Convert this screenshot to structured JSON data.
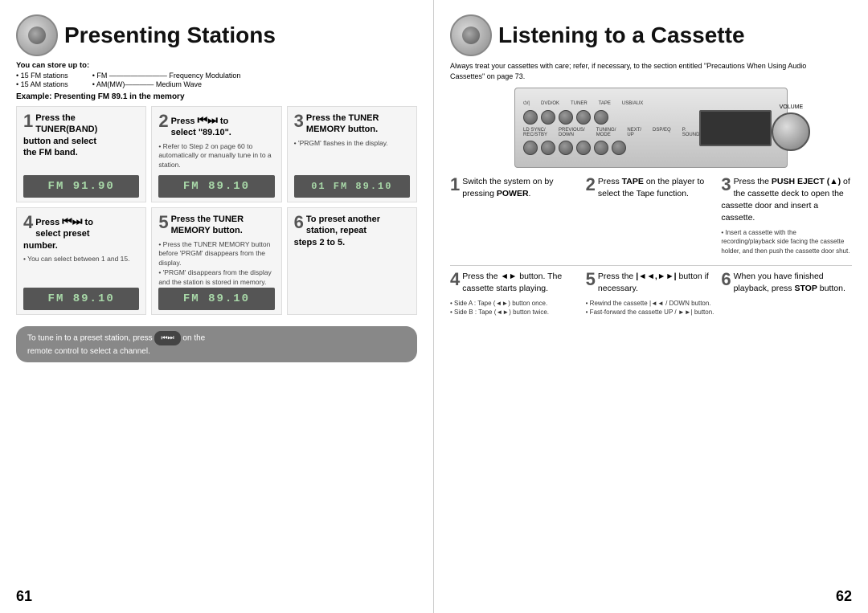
{
  "left": {
    "title": "Presenting Stations",
    "speaker_alt": "speaker icon",
    "info": {
      "title": "You can store up to:",
      "col1": [
        "• 15 FM stations",
        "• 15 AM stations"
      ],
      "col2": [
        "• FM ————————— Frequency Modulation",
        "• AM(MW)————— Medium Wave"
      ]
    },
    "example_header": "Example: Presenting FM 89.1 in the memory",
    "steps": [
      {
        "number": "1",
        "title": "Press the TUNER(BAND) button  and select the FM band.",
        "body": "",
        "notes": "",
        "lcd": "FM 91.90"
      },
      {
        "number": "2",
        "title": "Press  to select \"89.10\".",
        "body": "",
        "notes": "• Refer to Step 2 on page 60 to automatically or manually tune in to a station.",
        "lcd": "FM 89.10"
      },
      {
        "number": "3",
        "title": "Press the TUNER MEMORY button.",
        "body": "",
        "notes": "• 'PRGM' flashes in the display.",
        "lcd": "01 FM 89.10"
      },
      {
        "number": "4",
        "title": "Press  to select preset number.",
        "body": "",
        "notes": "• You can select between 1 and 15.",
        "lcd": "FM 89.10"
      },
      {
        "number": "5",
        "title": "Press the TUNER MEMORY button.",
        "body": "",
        "notes": "• Press the TUNER MEMORY button before 'PRGM' disappears from the display.\n• 'PRGM' disappears from the display and the station is stored in memory.",
        "lcd": "FM 89.10"
      },
      {
        "number": "6",
        "title": "To preset another station, repeat steps 2 to 5.",
        "body": "",
        "notes": "",
        "lcd": ""
      }
    ],
    "bottom_note": "To tune in to a preset station, press       on the remote control to select a channel.",
    "page_number": "61"
  },
  "right": {
    "title": "Listening to a Cassette",
    "speaker_alt": "speaker icon",
    "info": "Always treat your cassettes with care; refer, if necessary, to the section entitled \"Precautions When Using Audio Cassettes\" on page 73.",
    "steps_top": [
      {
        "number": "1",
        "content": "Switch the system on by pressing POWER.",
        "notes": ""
      },
      {
        "number": "2",
        "content": "Press TAPE on the player to select the Tape function.",
        "notes": ""
      },
      {
        "number": "3",
        "content": "Press the PUSH EJECT (▲) of the cassette deck to open the cassette door and insert a cassette.",
        "notes": "• Insert a cassette with the recording/playback side facing the cassette holder, and then push the cassette door shut."
      }
    ],
    "steps_bottom": [
      {
        "number": "4",
        "content": "Press the ◄► button. The cassette starts playing.",
        "notes": "• Side A : Tape (◄►) button once.\n• Side B : Tape (◄►) button twice."
      },
      {
        "number": "5",
        "content": "Press the |◄◄,►►| button if necessary.",
        "notes": "• Rewind the cassette |◄◄ / DOWN button.\n• Fast-forward the cassette UP / ►►| button."
      },
      {
        "number": "6",
        "content": "When you have finished playback, press STOP button.",
        "notes": ""
      }
    ],
    "page_number": "62"
  }
}
